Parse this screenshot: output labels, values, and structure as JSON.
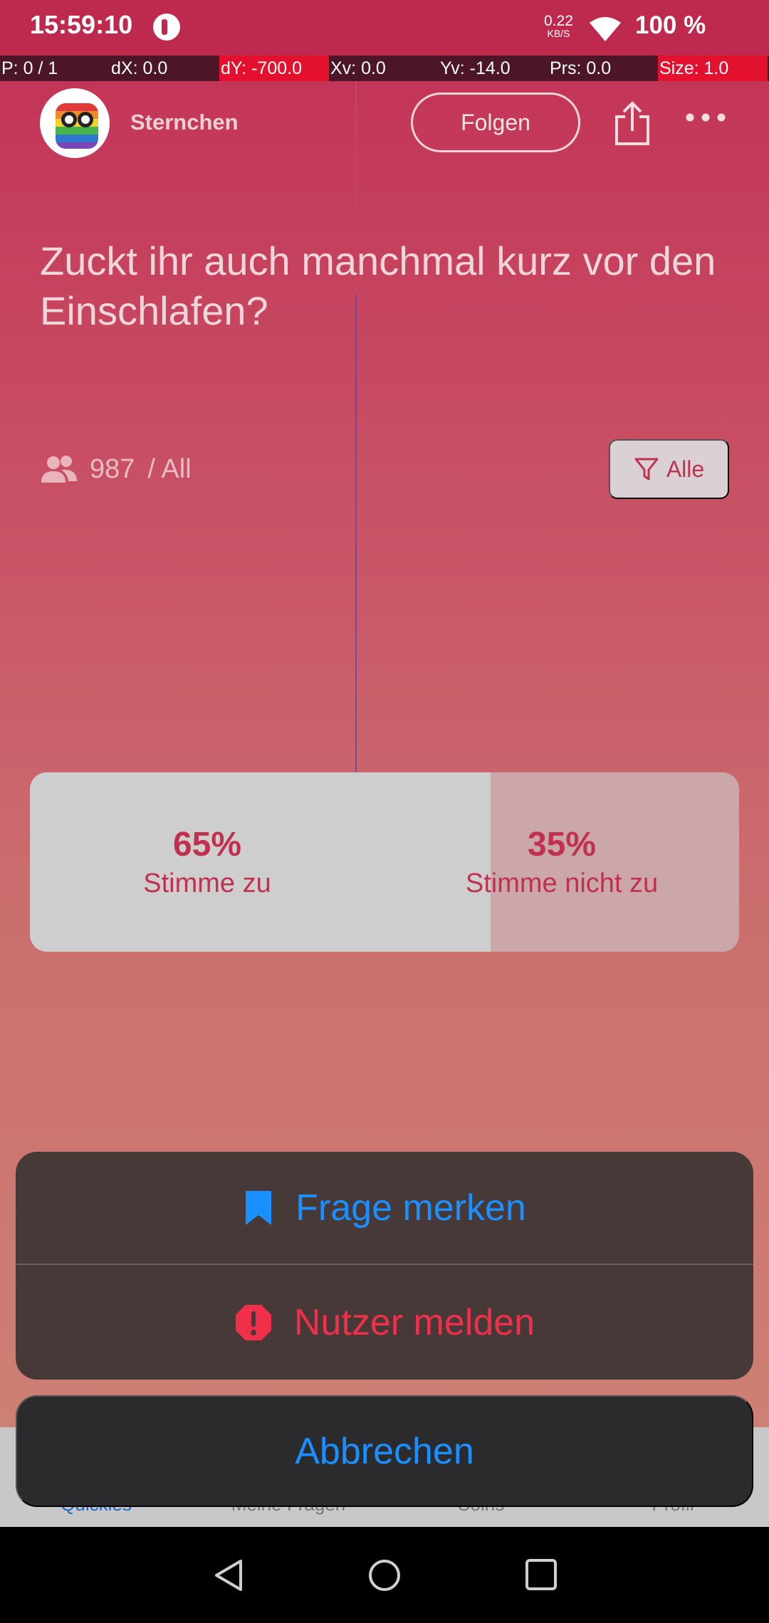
{
  "status_bar": {
    "time": "15:59:10",
    "net_speed": "0.22",
    "net_unit": "KB/S",
    "battery": "100 %"
  },
  "debug_bar": {
    "pointer": "P: 0 / 1",
    "dx": "dX: 0.0",
    "dy": "dY: -700.0",
    "xv": "Xv: 0.0",
    "yv": "Yv: -14.0",
    "prs": "Prs: 0.0",
    "size": "Size: 1.0"
  },
  "header": {
    "username": "Sternchen",
    "follow_label": "Folgen"
  },
  "question": {
    "text": "Zuckt ihr auch manchmal kurz vor den Einschlafen?",
    "participants": "987",
    "audience": "/ All",
    "filter_label": "Alle"
  },
  "poll": {
    "options": [
      {
        "percent": "65%",
        "label": "Stimme zu",
        "share": 0.65
      },
      {
        "percent": "35%",
        "label": "Stimme nicht zu",
        "share": 0.35
      }
    ]
  },
  "bottom_nav": {
    "items": [
      {
        "label": "Quickies",
        "active": true
      },
      {
        "label": "Meine Fragen",
        "active": false
      },
      {
        "label": "Coins",
        "active": false
      },
      {
        "label": "Profil",
        "active": false
      }
    ]
  },
  "action_sheet": {
    "save_label": "Frage merken",
    "report_label": "Nutzer melden",
    "cancel_label": "Abbrechen"
  },
  "colors": {
    "brand": "#bd2a4d",
    "accent_blue": "#1a8fff",
    "alert_red": "#f0304a"
  }
}
